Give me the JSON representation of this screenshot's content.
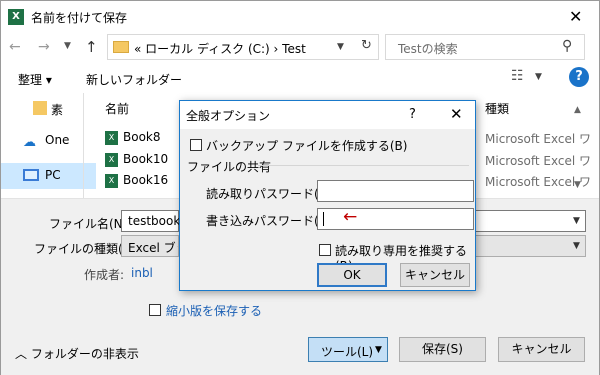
{
  "window": {
    "title": "名前を付けて保存",
    "app_icon": "excel-icon",
    "close_glyph": "✕"
  },
  "address": {
    "path": "« ローカル ディスク (C:)  ›  Test",
    "search_placeholder": "Testの検索"
  },
  "toolbar": {
    "organize": "整理 ▾",
    "new_folder": "新しいフォルダー",
    "help": "?"
  },
  "nav": {
    "quick_access": "素",
    "onedrive": "One",
    "pc": "PC"
  },
  "filelist": {
    "col_name": "名前",
    "col_type": "種類",
    "files": [
      {
        "name": "Book8",
        "type": "Microsoft Excel ワ"
      },
      {
        "name": "Book10",
        "type": "Microsoft Excel ワ"
      },
      {
        "name": "Book16",
        "type": "Microsoft Excel ワ"
      }
    ]
  },
  "form": {
    "filename_label": "ファイル名(N):",
    "filename_value": "testbook",
    "filetype_label": "ファイルの種類(T):",
    "filetype_value": "Excel ブック",
    "author_label": "作成者:",
    "author_value": "inbl",
    "thumbnail_label": "縮小版を保存する"
  },
  "footer": {
    "hide_folders": "フォルダーの非表示",
    "tools_label": "ツール(L)",
    "save_label": "保存(S)",
    "cancel_label": "キャンセル"
  },
  "modal": {
    "title": "全般オプション",
    "help": "?",
    "backup_label": "バックアップ ファイルを作成する(B)",
    "section_label": "ファイルの共有",
    "read_pw_label": "読み取りパスワード(O):",
    "write_pw_label": "書き込みパスワード(M):",
    "readonly_label": "読み取り専用を推奨する(R)",
    "ok_label": "OK",
    "cancel_label": "キャンセル",
    "annotation_arrow": "←"
  },
  "colors": {
    "accent": "#1979ca",
    "link": "#1a5fb4",
    "annotation": "#c00000",
    "selected_nav": "#cce8ff"
  }
}
